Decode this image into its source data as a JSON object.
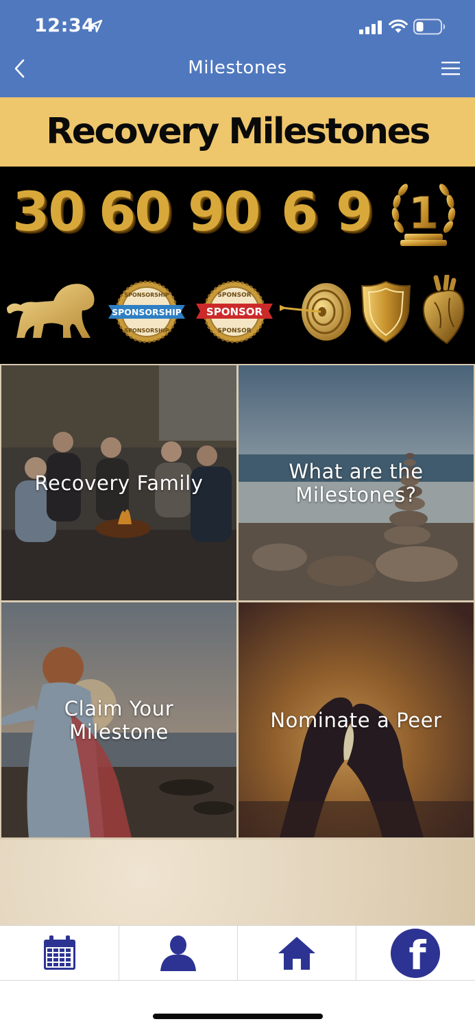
{
  "status_bar": {
    "time": "12:34"
  },
  "nav": {
    "title": "Milestones"
  },
  "banner": {
    "title": "Recovery Milestones",
    "numbers": [
      "30",
      "60",
      "90",
      "6",
      "9"
    ],
    "badge_one": "1",
    "seal_sponsorship": {
      "ribbon": "SPONSORSHIP",
      "ring": "SPONSORSHIP"
    },
    "seal_sponsor": {
      "ribbon": "SPONSOR",
      "ring": "SPONSOR"
    }
  },
  "tiles": [
    {
      "label": "Recovery Family"
    },
    {
      "label": "What are the\nMilestones?"
    },
    {
      "label": "Claim Your\nMilestone"
    },
    {
      "label": "Nominate a Peer"
    }
  ],
  "tabbar": {
    "icons": [
      "calendar-icon",
      "profile-icon",
      "home-icon",
      "facebook-icon"
    ],
    "facebook_glyph": "f"
  },
  "colors": {
    "header_blue": "#5078be",
    "banner_gold": "#eec66c",
    "tab_icon_navy": "#2c3393"
  }
}
